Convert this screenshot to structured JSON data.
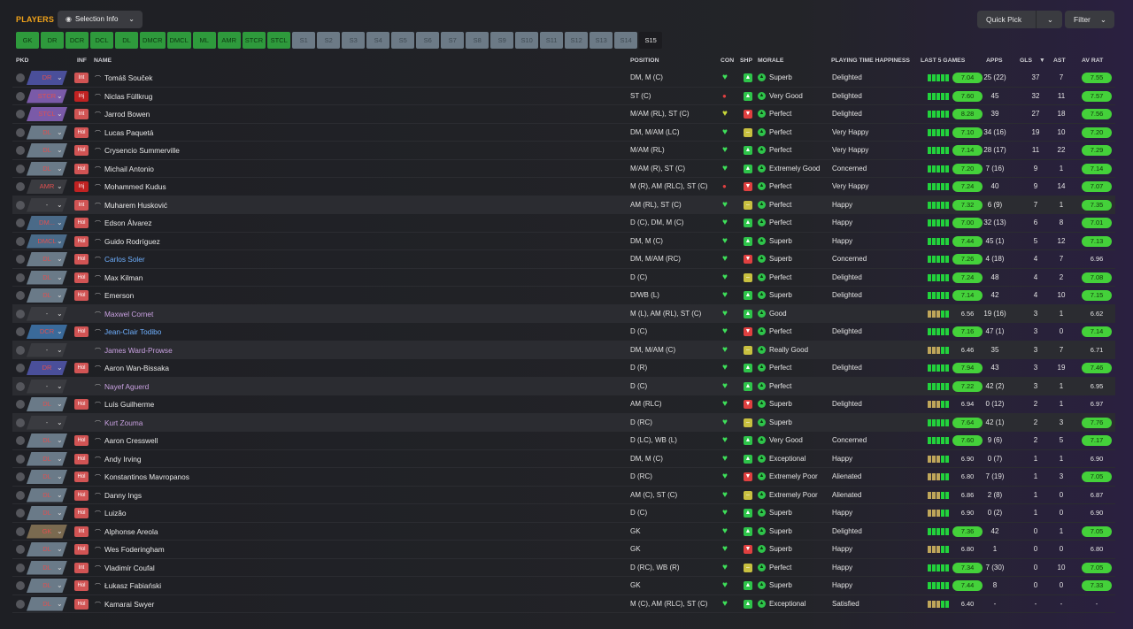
{
  "header": {
    "title": "PLAYERS",
    "selection_info": "Selection Info",
    "quick_pick": "Quick Pick",
    "filter": "Filter"
  },
  "position_filters": [
    "GK",
    "DR",
    "DCR",
    "DCL",
    "DL",
    "DMCR",
    "DMCL",
    "ML",
    "AMR",
    "STCR",
    "STCL",
    "S1",
    "S2",
    "S3",
    "S4",
    "S5",
    "S6",
    "S7",
    "S8",
    "S9",
    "S10",
    "S11",
    "S12",
    "S13",
    "S14",
    "S15"
  ],
  "columns": {
    "pkd": "PKD",
    "inf": "INF",
    "name": "NAME",
    "position": "POSITION",
    "con": "CON",
    "shp": "SHP",
    "morale": "MORALE",
    "playing_time": "PLAYING TIME HAPPINESS",
    "last5": "LAST 5 GAMES",
    "apps": "APPS",
    "gls": "GLS",
    "sort": "▼",
    "ast": "AST",
    "avrat": "AV RAT"
  },
  "colors": {
    "accent": "#f0a21a",
    "good": "#44d13a",
    "bad": "#e04040"
  },
  "players": [
    {
      "pkd": "DR",
      "inf": "Int",
      "name": "Tomáš Souček",
      "position": "DM, M (C)",
      "morale": "Superb",
      "pt": "Delighted",
      "last5": "7.04",
      "apps": "25 (22)",
      "gls": "37",
      "ast": "7",
      "avrat": "7.55"
    },
    {
      "pkd": "STCR",
      "inf": "Inj",
      "name": "Niclas Füllkrug",
      "position": "ST (C)",
      "morale": "Very Good",
      "pt": "Delighted",
      "last5": "7.60",
      "apps": "45",
      "gls": "32",
      "ast": "11",
      "avrat": "7.57"
    },
    {
      "pkd": "STCL",
      "inf": "Int",
      "name": "Jarrod Bowen",
      "position": "M/AM (RL), ST (C)",
      "morale": "Perfect",
      "pt": "Delighted",
      "last5": "8.28",
      "apps": "39",
      "gls": "27",
      "ast": "18",
      "avrat": "7.56"
    },
    {
      "pkd": "DL",
      "inf": "Hol",
      "name": "Lucas Paquetá",
      "position": "DM, M/AM (LC)",
      "morale": "Perfect",
      "pt": "Very Happy",
      "last5": "7.10",
      "apps": "34 (16)",
      "gls": "19",
      "ast": "10",
      "avrat": "7.20"
    },
    {
      "pkd": "DL",
      "inf": "Hol",
      "name": "Crysencio Summerville",
      "position": "M/AM (RL)",
      "morale": "Perfect",
      "pt": "Very Happy",
      "last5": "7.14",
      "apps": "28 (17)",
      "gls": "11",
      "ast": "22",
      "avrat": "7.29"
    },
    {
      "pkd": "DL",
      "inf": "Hol",
      "name": "Michail Antonio",
      "position": "M/AM (R), ST (C)",
      "morale": "Extremely Good",
      "pt": "Concerned",
      "last5": "7.20",
      "apps": "7 (16)",
      "gls": "9",
      "ast": "1",
      "avrat": "7.14"
    },
    {
      "pkd": "AMR",
      "inf": "Inj",
      "name": "Mohammed Kudus",
      "position": "M (R), AM (RLC), ST (C)",
      "morale": "Perfect",
      "pt": "Very Happy",
      "last5": "7.24",
      "apps": "40",
      "gls": "9",
      "ast": "14",
      "avrat": "7.07"
    },
    {
      "pkd": "-",
      "inf": "Int",
      "name": "Muharem Husković",
      "position": "AM (RL), ST (C)",
      "morale": "Perfect",
      "pt": "Happy",
      "last5": "7.32",
      "apps": "6 (9)",
      "gls": "7",
      "ast": "1",
      "avrat": "7.35"
    },
    {
      "pkd": "DM...",
      "inf": "Hol",
      "name": "Edson Álvarez",
      "position": "D (C), DM, M (C)",
      "morale": "Perfect",
      "pt": "Happy",
      "last5": "7.00",
      "apps": "32 (13)",
      "gls": "6",
      "ast": "8",
      "avrat": "7.01"
    },
    {
      "pkd": "DMCL",
      "inf": "Hol",
      "name": "Guido Rodríguez",
      "position": "DM, M (C)",
      "morale": "Superb",
      "pt": "Happy",
      "last5": "7.44",
      "apps": "45 (1)",
      "gls": "5",
      "ast": "12",
      "avrat": "7.13"
    },
    {
      "pkd": "DL",
      "inf": "Hol",
      "name": "Carlos Soler",
      "position": "DM, M/AM (RC)",
      "morale": "Superb",
      "pt": "Concerned",
      "last5": "7.26",
      "apps": "4 (18)",
      "gls": "4",
      "ast": "7",
      "avrat": "6.96"
    },
    {
      "pkd": "DL",
      "inf": "Hol",
      "name": "Max Kilman",
      "position": "D (C)",
      "morale": "Perfect",
      "pt": "Delighted",
      "last5": "7.24",
      "apps": "48",
      "gls": "4",
      "ast": "2",
      "avrat": "7.08"
    },
    {
      "pkd": "DL",
      "inf": "Hol",
      "name": "Emerson",
      "position": "D/WB (L)",
      "morale": "Superb",
      "pt": "Delighted",
      "last5": "7.14",
      "apps": "42",
      "gls": "4",
      "ast": "10",
      "avrat": "7.15"
    },
    {
      "pkd": "-",
      "inf": "",
      "name": "Maxwel Cornet",
      "position": "M (L), AM (RL), ST (C)",
      "morale": "Good",
      "pt": "",
      "last5": "6.56",
      "apps": "19 (16)",
      "gls": "3",
      "ast": "1",
      "avrat": "6.62"
    },
    {
      "pkd": "DCR",
      "inf": "Hol",
      "name": "Jean-Clair Todibo",
      "position": "D (C)",
      "morale": "Perfect",
      "pt": "Delighted",
      "last5": "7.16",
      "apps": "47 (1)",
      "gls": "3",
      "ast": "0",
      "avrat": "7.14"
    },
    {
      "pkd": "-",
      "inf": "",
      "name": "James Ward-Prowse",
      "position": "DM, M/AM (C)",
      "morale": "Really Good",
      "pt": "",
      "last5": "6.46",
      "apps": "35",
      "gls": "3",
      "ast": "7",
      "avrat": "6.71"
    },
    {
      "pkd": "DR",
      "inf": "Hol",
      "name": "Aaron Wan-Bissaka",
      "position": "D (R)",
      "morale": "Perfect",
      "pt": "Delighted",
      "last5": "7.94",
      "apps": "43",
      "gls": "3",
      "ast": "19",
      "avrat": "7.46"
    },
    {
      "pkd": "-",
      "inf": "",
      "name": "Nayef Aguerd",
      "position": "D (C)",
      "morale": "Perfect",
      "pt": "",
      "last5": "7.22",
      "apps": "42 (2)",
      "gls": "3",
      "ast": "1",
      "avrat": "6.95"
    },
    {
      "pkd": "DL",
      "inf": "Hol",
      "name": "Luís Guilherme",
      "position": "AM (RLC)",
      "morale": "Superb",
      "pt": "Delighted",
      "last5": "6.94",
      "apps": "0 (12)",
      "gls": "2",
      "ast": "1",
      "avrat": "6.97"
    },
    {
      "pkd": "-",
      "inf": "",
      "name": "Kurt Zouma",
      "position": "D (RC)",
      "morale": "Superb",
      "pt": "",
      "last5": "7.64",
      "apps": "42 (1)",
      "gls": "2",
      "ast": "3",
      "avrat": "7.76"
    },
    {
      "pkd": "DL",
      "inf": "Hol",
      "name": "Aaron Cresswell",
      "position": "D (LC), WB (L)",
      "morale": "Very Good",
      "pt": "Concerned",
      "last5": "7.60",
      "apps": "9 (6)",
      "gls": "2",
      "ast": "5",
      "avrat": "7.17"
    },
    {
      "pkd": "DL",
      "inf": "Hol",
      "name": "Andy Irving",
      "position": "DM, M (C)",
      "morale": "Exceptional",
      "pt": "Happy",
      "last5": "6.90",
      "apps": "0 (7)",
      "gls": "1",
      "ast": "1",
      "avrat": "6.90"
    },
    {
      "pkd": "DL",
      "inf": "Hol",
      "name": "Konstantinos Mavropanos",
      "position": "D (RC)",
      "morale": "Extremely Poor",
      "pt": "Alienated",
      "last5": "6.80",
      "apps": "7 (19)",
      "gls": "1",
      "ast": "3",
      "avrat": "7.05"
    },
    {
      "pkd": "DL",
      "inf": "Hol",
      "name": "Danny Ings",
      "position": "AM (C), ST (C)",
      "morale": "Extremely Poor",
      "pt": "Alienated",
      "last5": "6.86",
      "apps": "2 (8)",
      "gls": "1",
      "ast": "0",
      "avrat": "6.87"
    },
    {
      "pkd": "DL",
      "inf": "Hol",
      "name": "Luizão",
      "position": "D (C)",
      "morale": "Superb",
      "pt": "Happy",
      "last5": "6.90",
      "apps": "0 (2)",
      "gls": "1",
      "ast": "0",
      "avrat": "6.90"
    },
    {
      "pkd": "GK",
      "inf": "Int",
      "name": "Alphonse Areola",
      "position": "GK",
      "morale": "Superb",
      "pt": "Delighted",
      "last5": "7.36",
      "apps": "42",
      "gls": "0",
      "ast": "1",
      "avrat": "7.05"
    },
    {
      "pkd": "DL",
      "inf": "Hol",
      "name": "Wes Foderingham",
      "position": "GK",
      "morale": "Superb",
      "pt": "Happy",
      "last5": "6.80",
      "apps": "1",
      "gls": "0",
      "ast": "0",
      "avrat": "6.80"
    },
    {
      "pkd": "DL",
      "inf": "Int",
      "name": "Vladimír Coufal",
      "position": "D (RC), WB (R)",
      "morale": "Perfect",
      "pt": "Happy",
      "last5": "7.34",
      "apps": "7 (30)",
      "gls": "0",
      "ast": "10",
      "avrat": "7.05"
    },
    {
      "pkd": "DL",
      "inf": "Hol",
      "name": "Łukasz Fabiański",
      "position": "GK",
      "morale": "Superb",
      "pt": "Happy",
      "last5": "7.44",
      "apps": "8",
      "gls": "0",
      "ast": "0",
      "avrat": "7.33"
    },
    {
      "pkd": "DL",
      "inf": "Hol",
      "name": "Kamarai Swyer",
      "position": "M (C), AM (RLC), ST (C)",
      "morale": "Exceptional",
      "pt": "Satisfied",
      "last5": "6.40",
      "apps": "-",
      "gls": "-",
      "ast": "-",
      "avrat": "-"
    }
  ]
}
